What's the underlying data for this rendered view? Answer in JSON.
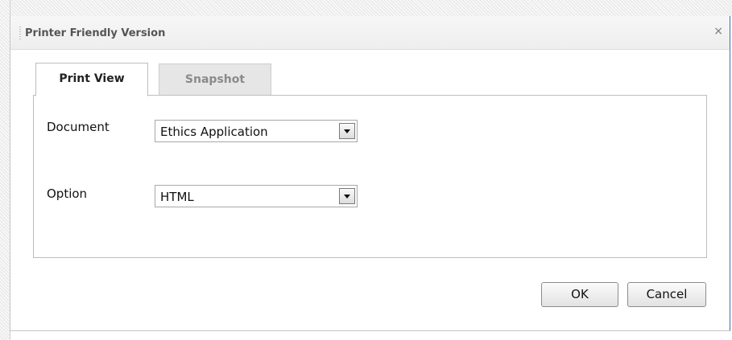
{
  "dialog": {
    "title": "Printer Friendly Version",
    "close_icon": "close-icon"
  },
  "tabs": [
    {
      "label": "Print View",
      "active": true
    },
    {
      "label": "Snapshot",
      "active": false
    }
  ],
  "form": {
    "document": {
      "label": "Document",
      "value": "Ethics Application"
    },
    "option": {
      "label": "Option",
      "value": "HTML"
    }
  },
  "buttons": {
    "ok_label": "OK",
    "cancel_label": "Cancel"
  },
  "colors": {
    "right_border": "#3b6ea8",
    "inactive_tab_bg": "#e6e6e6",
    "inactive_tab_text": "#8a8a8a"
  }
}
